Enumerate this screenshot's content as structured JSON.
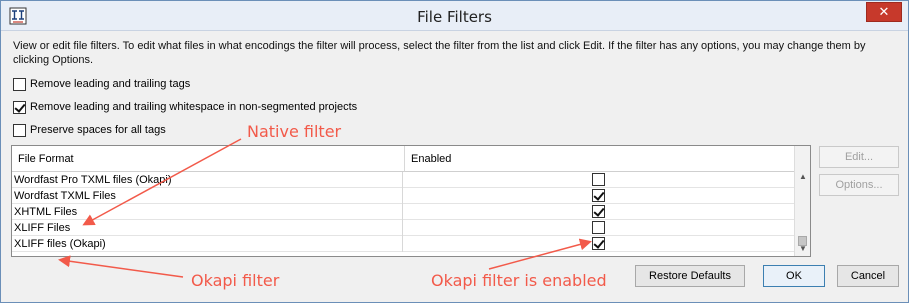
{
  "window": {
    "title": "File Filters",
    "close_label": "✕"
  },
  "description": "View or edit file filters. To edit what files in what encodings the filter will process, select the filter from the list and click Edit. If the filter has any options, you may change them by clicking Options.",
  "options": [
    {
      "label": "Remove leading and trailing tags",
      "checked": false
    },
    {
      "label": "Remove leading and trailing whitespace in non-segmented projects",
      "checked": true
    },
    {
      "label": "Preserve spaces for all tags",
      "checked": false
    }
  ],
  "table": {
    "headers": [
      "File Format",
      "Enabled"
    ],
    "rows": [
      {
        "name": "Wordfast Pro TXML files (Okapi)",
        "enabled": false
      },
      {
        "name": "Wordfast TXML Files",
        "enabled": true
      },
      {
        "name": "XHTML Files",
        "enabled": true
      },
      {
        "name": "XLIFF Files",
        "enabled": false
      },
      {
        "name": "XLIFF files (Okapi)",
        "enabled": true
      }
    ]
  },
  "side_buttons": {
    "edit_label": "Edit...",
    "options_label": "Options..."
  },
  "footer_buttons": {
    "restore_label": "Restore Defaults",
    "ok_label": "OK",
    "cancel_label": "Cancel"
  },
  "annotations": {
    "native": "Native filter",
    "okapi": "Okapi filter",
    "okapi_enabled": "Okapi filter is enabled",
    "color": "#f25a4a"
  }
}
